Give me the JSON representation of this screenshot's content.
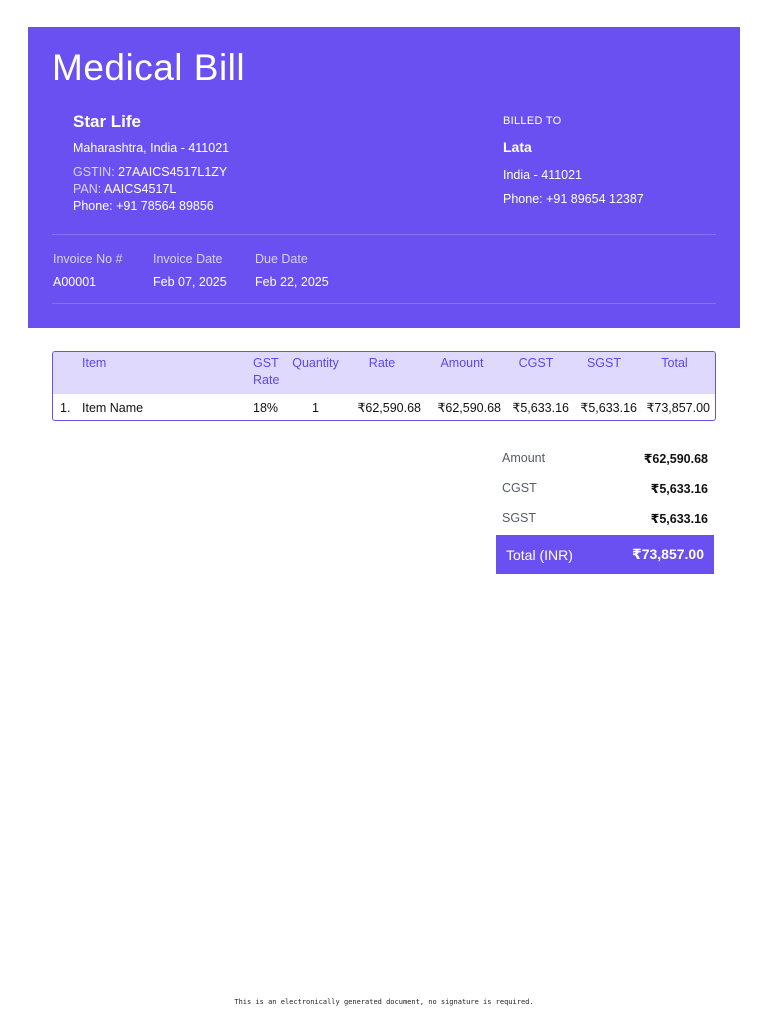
{
  "document": {
    "title": "Medical Bill"
  },
  "seller": {
    "name": "Star Life",
    "address": "Maharashtra, India - 411021",
    "gstin_label": "GSTIN:",
    "gstin": "27AAICS4517L1ZY",
    "pan_label": "PAN:",
    "pan": "AAICS4517L",
    "phone": "Phone: +91 78564 89856"
  },
  "buyer": {
    "billed_to_label": "BILLED TO",
    "name": "Lata",
    "address": "India - 411021",
    "phone": "Phone: +91 89654 12387"
  },
  "invoice": {
    "number_label": "Invoice No #",
    "number": "A00001",
    "date_label": "Invoice Date",
    "date": "Feb 07, 2025",
    "due_label": "Due Date",
    "due": "Feb 22, 2025"
  },
  "table": {
    "headers": {
      "item": "Item",
      "gst_rate": "GST Rate",
      "quantity": "Quantity",
      "rate": "Rate",
      "amount": "Amount",
      "cgst": "CGST",
      "sgst": "SGST",
      "total": "Total"
    },
    "rows": [
      {
        "index": "1.",
        "item": "Item Name",
        "gst_rate": "18%",
        "quantity": "1",
        "rate": "₹62,590.68",
        "amount": "₹62,590.68",
        "cgst": "₹5,633.16",
        "sgst": "₹5,633.16",
        "total": "₹73,857.00"
      }
    ]
  },
  "summary": {
    "amount_label": "Amount",
    "amount": "₹62,590.68",
    "cgst_label": "CGST",
    "cgst": "₹5,633.16",
    "sgst_label": "SGST",
    "sgst": "₹5,633.16",
    "total_label": "Total (INR)",
    "total": "₹73,857.00"
  },
  "footer": {
    "note": "This is an electronically generated document, no signature is required."
  },
  "colors": {
    "accent": "#6a50f0",
    "table_header_bg": "#dfdafd",
    "header_text_accent": "#5f46ea"
  }
}
